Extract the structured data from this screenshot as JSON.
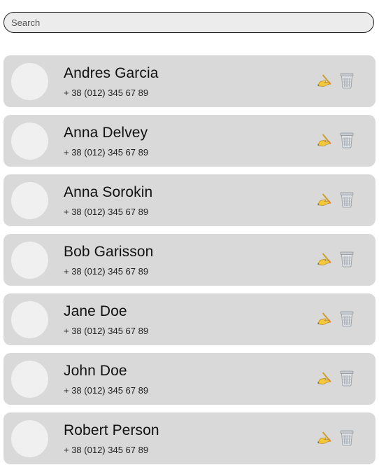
{
  "search": {
    "placeholder": "Search",
    "value": ""
  },
  "contacts": [
    {
      "name": "Andres Garcia",
      "phone": "+ 38 (012) 345 67 89"
    },
    {
      "name": "Anna Delvey",
      "phone": "+ 38 (012) 345 67 89"
    },
    {
      "name": "Anna Sorokin",
      "phone": "+ 38 (012) 345 67 89"
    },
    {
      "name": "Bob Garisson",
      "phone": "+ 38 (012) 345 67 89"
    },
    {
      "name": "Jane Doe",
      "phone": "+ 38 (012) 345 67 89"
    },
    {
      "name": "John Doe",
      "phone": "+ 38 (012) 345 67 89"
    },
    {
      "name": "Robert Person",
      "phone": "+ 38 (012) 345 67 89"
    }
  ],
  "icons": {
    "edit": "writing-hand-icon",
    "delete": "trash-bin-icon"
  },
  "colors": {
    "card": "#d9d9d9",
    "avatar": "#f1f0f0",
    "search_bg": "#ececec"
  }
}
